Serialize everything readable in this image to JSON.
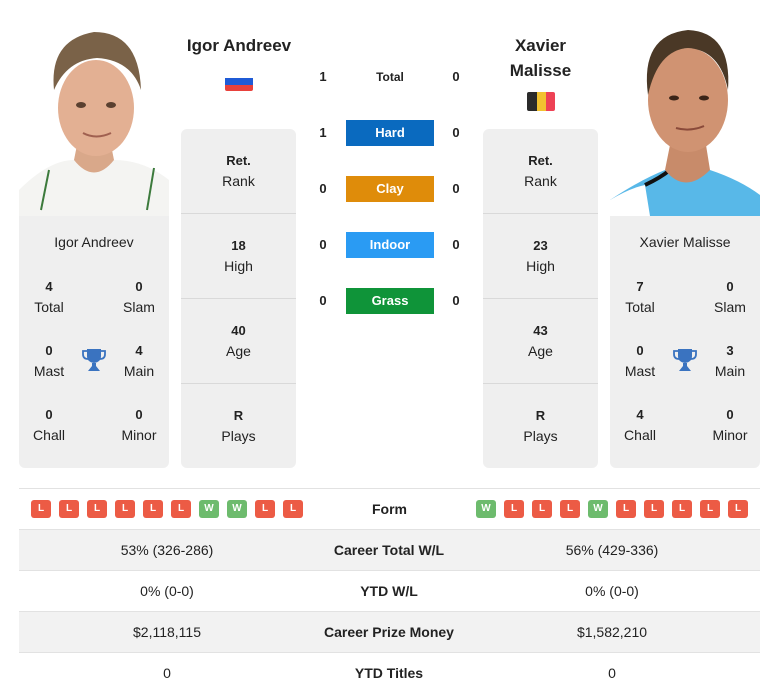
{
  "players": {
    "left": {
      "name": "Igor Andreev",
      "card_name": "Igor Andreev",
      "flag": "russia-flag",
      "flag_colors": [
        "#ffffff",
        "#1f5bd6",
        "#e8413b"
      ],
      "titles": {
        "total": {
          "value": "4",
          "label": "Total"
        },
        "slam": {
          "value": "0",
          "label": "Slam"
        },
        "mast": {
          "value": "0",
          "label": "Mast"
        },
        "main": {
          "value": "4",
          "label": "Main"
        },
        "chall": {
          "value": "0",
          "label": "Chall"
        },
        "minor": {
          "value": "0",
          "label": "Minor"
        }
      },
      "rank": {
        "rank": {
          "value": "Ret.",
          "label": "Rank"
        },
        "high": {
          "value": "18",
          "label": "High"
        },
        "age": {
          "value": "40",
          "label": "Age"
        },
        "plays": {
          "value": "R",
          "label": "Plays"
        }
      },
      "form": [
        "L",
        "L",
        "L",
        "L",
        "L",
        "L",
        "W",
        "W",
        "L",
        "L"
      ]
    },
    "right": {
      "name": "Xavier Malisse",
      "card_name": "Xavier Malisse",
      "flag": "belgium-flag",
      "flag_colors": [
        "#2b2b2b",
        "#f2c230",
        "#ee4155"
      ],
      "titles": {
        "total": {
          "value": "7",
          "label": "Total"
        },
        "slam": {
          "value": "0",
          "label": "Slam"
        },
        "mast": {
          "value": "0",
          "label": "Mast"
        },
        "main": {
          "value": "3",
          "label": "Main"
        },
        "chall": {
          "value": "4",
          "label": "Chall"
        },
        "minor": {
          "value": "0",
          "label": "Minor"
        }
      },
      "rank": {
        "rank": {
          "value": "Ret.",
          "label": "Rank"
        },
        "high": {
          "value": "23",
          "label": "High"
        },
        "age": {
          "value": "43",
          "label": "Age"
        },
        "plays": {
          "value": "R",
          "label": "Plays"
        }
      },
      "form": [
        "W",
        "L",
        "L",
        "L",
        "W",
        "L",
        "L",
        "L",
        "L",
        "L"
      ]
    }
  },
  "h2h": {
    "total": {
      "label": "Total",
      "left": "1",
      "right": "0"
    },
    "surfaces": [
      {
        "label": "Hard",
        "left": "1",
        "right": "0",
        "color": "#0a6abf"
      },
      {
        "label": "Clay",
        "left": "0",
        "right": "0",
        "color": "#df8c0a"
      },
      {
        "label": "Indoor",
        "left": "0",
        "right": "0",
        "color": "#2a9bf3"
      },
      {
        "label": "Grass",
        "left": "0",
        "right": "0",
        "color": "#0f9439"
      }
    ]
  },
  "form_label": "Form",
  "table": [
    {
      "left": "53% (326-286)",
      "label": "Career Total W/L",
      "right": "56% (429-336)"
    },
    {
      "left": "0% (0-0)",
      "label": "YTD W/L",
      "right": "0% (0-0)"
    },
    {
      "left": "$2,118,115",
      "label": "Career Prize Money",
      "right": "$1,582,210"
    },
    {
      "left": "0",
      "label": "YTD Titles",
      "right": "0"
    }
  ],
  "colors": {
    "win": "#6dbb6d",
    "loss": "#ec5b45",
    "trophy": "#3a73c0",
    "card_bg": "#efefef"
  }
}
